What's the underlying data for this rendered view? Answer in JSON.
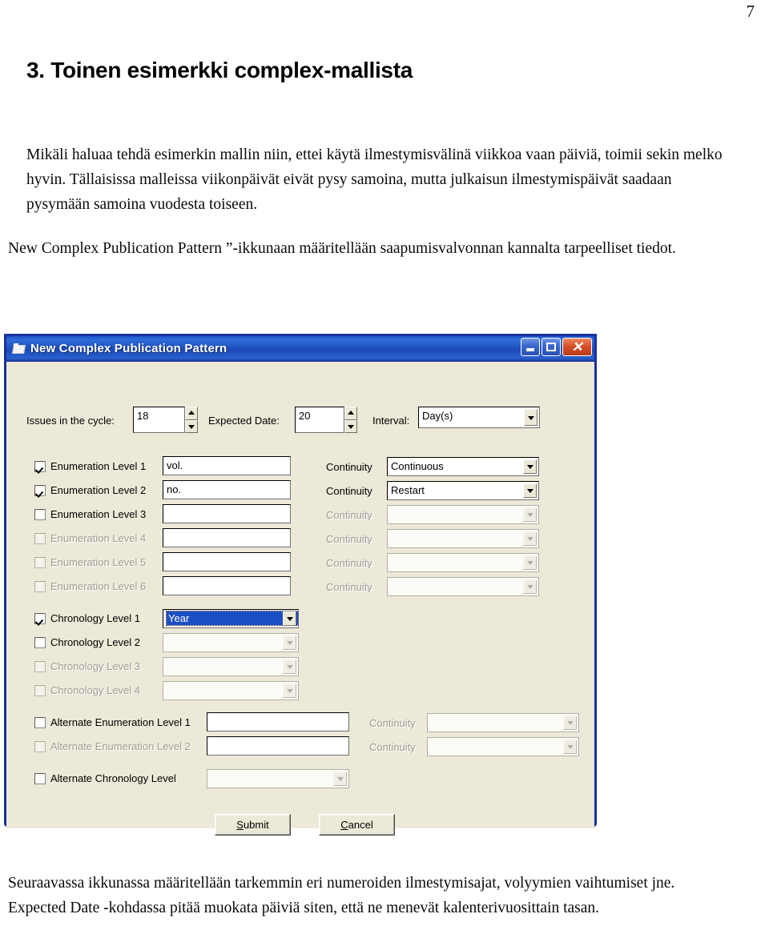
{
  "document": {
    "page_number": "7",
    "heading": "3. Toinen esimerkki complex-mallista",
    "paragraph_1": "Mikäli haluaa tehdä esimerkin mallin niin, ettei käytä ilmestymisvälinä viikkoa vaan päiviä, toimii sekin melko hyvin. Tällaisissa malleissa viikonpäivät eivät pysy samoina, mutta julkaisun ilmestymispäivät saadaan pysymään samoina vuodesta toiseen.",
    "paragraph_2": "New Complex Publication Pattern ”-ikkunaan määritellään saapumisvalvonnan kannalta tarpeelliset tiedot.",
    "paragraph_3": "Seuraavassa ikkunassa määritellään tarkemmin eri numeroiden ilmestymisajat, volyymien vaihtumiset jne. Expected Date -kohdassa pitää muokata päiviä siten, että ne menevät kalenterivuosittain tasan."
  },
  "dialog": {
    "title": "New Complex Publication Pattern",
    "title_icon": "window-icon",
    "titlebar_color": "#1c49b8",
    "client_color": "#ece9d8",
    "buttons": {
      "minimize": "minimize-icon",
      "maximize": "maximize-icon",
      "close": "close-icon",
      "close_glyph": "✕"
    },
    "top_row": {
      "issues_label": "Issues in the cycle:",
      "issues_value": "18",
      "expected_label": "Expected Date:",
      "expected_value": "20",
      "interval_label": "Interval:",
      "interval_value": "Day(s)"
    },
    "enumeration_rows": [
      {
        "label": "Enumeration Level 1",
        "checked": true,
        "enabled": true,
        "value": "vol.",
        "continuity_label": "Continuity",
        "continuity_value": "Continuous",
        "continuity_enabled": true
      },
      {
        "label": "Enumeration Level 2",
        "checked": true,
        "enabled": true,
        "value": "no.",
        "continuity_label": "Continuity",
        "continuity_value": "Restart",
        "continuity_enabled": true
      },
      {
        "label": "Enumeration Level 3",
        "checked": false,
        "enabled": true,
        "value": "",
        "continuity_label": "Continuity",
        "continuity_value": "",
        "continuity_enabled": false
      },
      {
        "label": "Enumeration Level 4",
        "checked": false,
        "enabled": false,
        "value": "",
        "continuity_label": "Continuity",
        "continuity_value": "",
        "continuity_enabled": false
      },
      {
        "label": "Enumeration Level 5",
        "checked": false,
        "enabled": false,
        "value": "",
        "continuity_label": "Continuity",
        "continuity_value": "",
        "continuity_enabled": false
      },
      {
        "label": "Enumeration Level 6",
        "checked": false,
        "enabled": false,
        "value": "",
        "continuity_label": "Continuity",
        "continuity_value": "",
        "continuity_enabled": false
      }
    ],
    "chronology_rows": [
      {
        "label": "Chronology Level 1",
        "checked": true,
        "enabled": true,
        "value": "Year",
        "selected": true
      },
      {
        "label": "Chronology Level 2",
        "checked": false,
        "enabled": true,
        "value": "",
        "selected": false
      },
      {
        "label": "Chronology Level 3",
        "checked": false,
        "enabled": false,
        "value": "",
        "selected": false
      },
      {
        "label": "Chronology Level 4",
        "checked": false,
        "enabled": false,
        "value": "",
        "selected": false
      }
    ],
    "alternate_enumeration_rows": [
      {
        "label": "Alternate Enumeration Level 1",
        "checked": false,
        "enabled": true,
        "value": "",
        "continuity_label": "Continuity",
        "continuity_value": "",
        "continuity_enabled": false
      },
      {
        "label": "Alternate Enumeration Level 2",
        "checked": false,
        "enabled": false,
        "value": "",
        "continuity_label": "Continuity",
        "continuity_value": "",
        "continuity_enabled": false
      }
    ],
    "alternate_chronology": {
      "label": "Alternate Chronology Level",
      "checked": false,
      "enabled": true,
      "value": ""
    },
    "actions": {
      "submit": {
        "accel": "S",
        "rest": "ubmit"
      },
      "cancel": {
        "accel": "C",
        "rest": "ancel"
      }
    }
  }
}
